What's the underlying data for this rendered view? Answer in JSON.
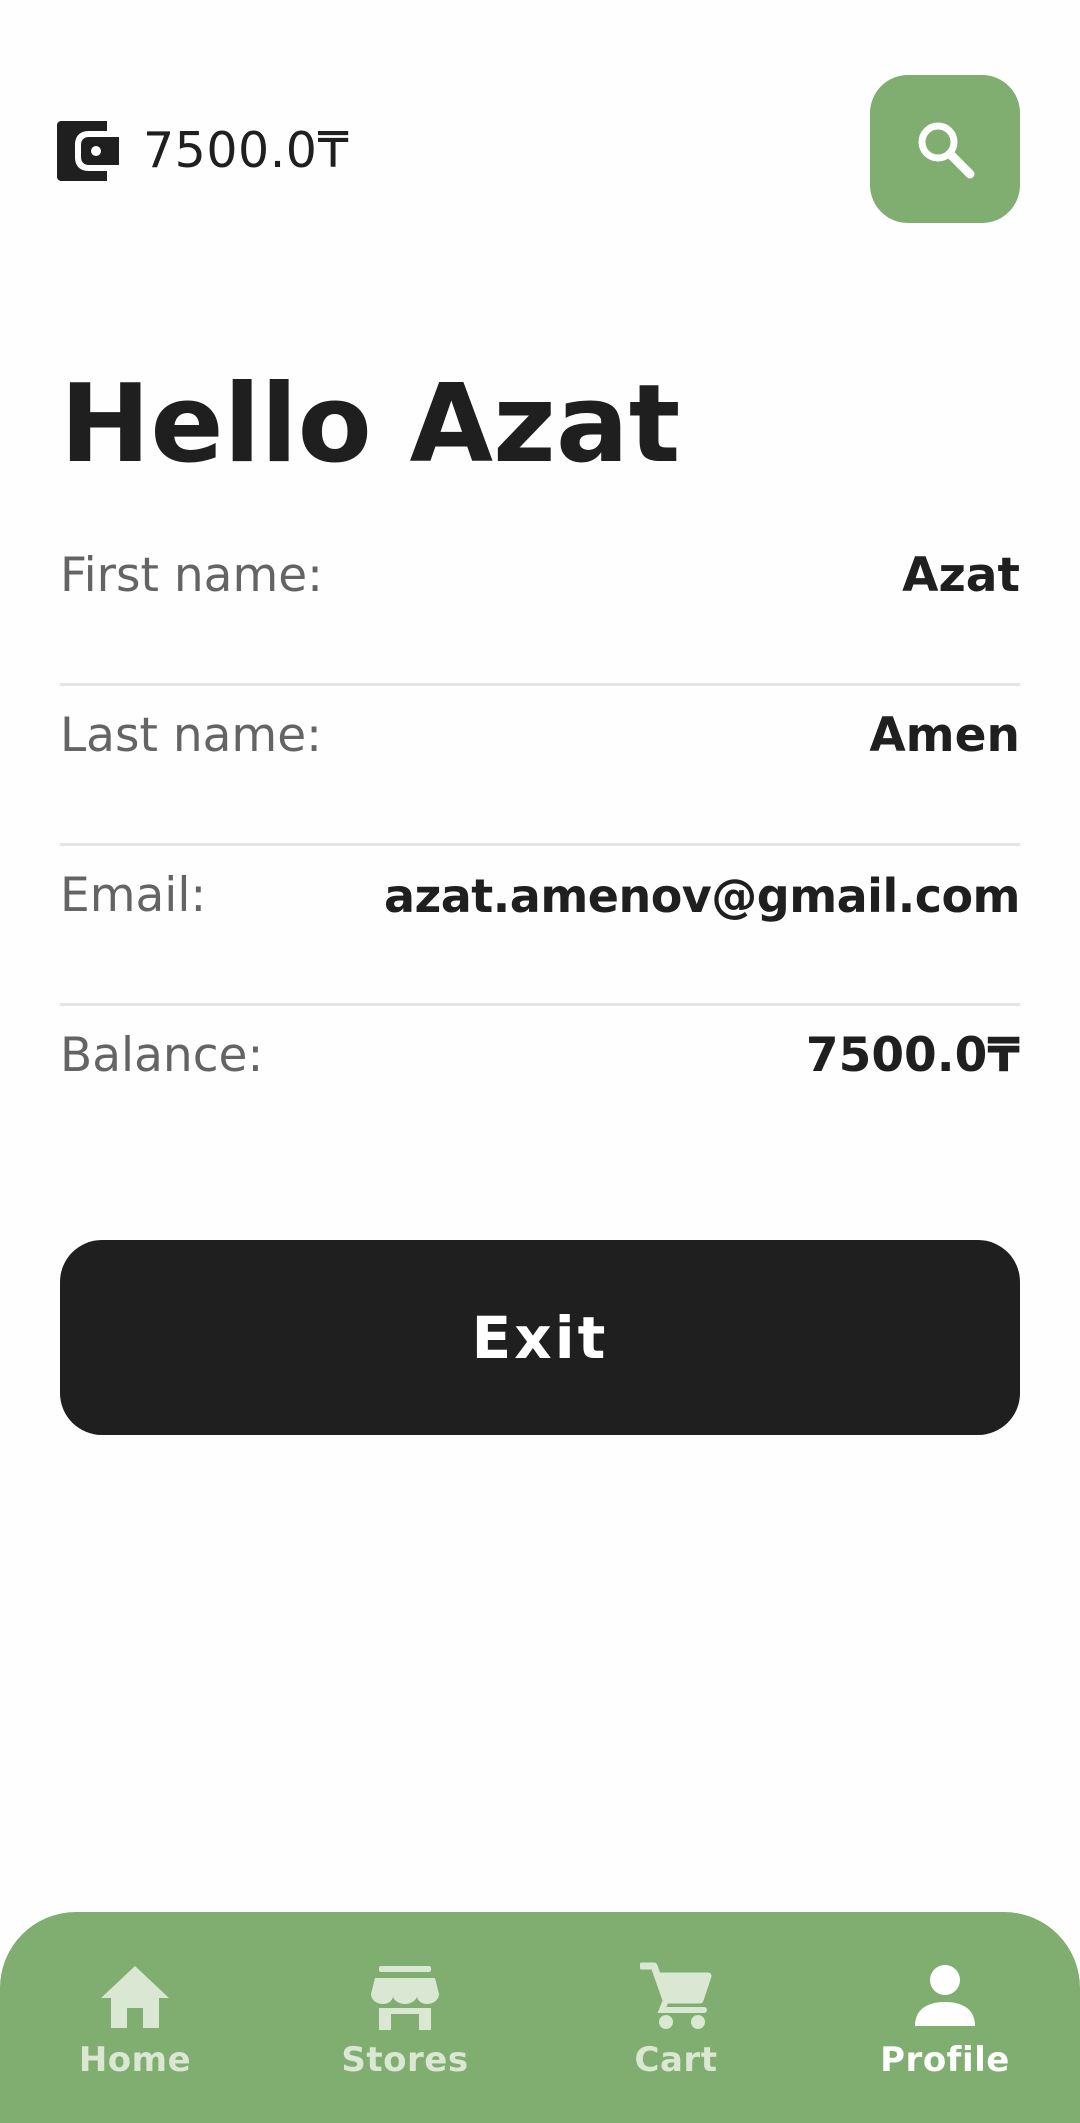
{
  "header": {
    "wallet_icon": "wallet-icon",
    "wallet_amount": "7500.0₸",
    "search_icon": "search-icon"
  },
  "greeting": "Hello Azat",
  "profile": {
    "fields": [
      {
        "label": "First name:",
        "value": "Azat"
      },
      {
        "label": "Last name:",
        "value": "Amen"
      },
      {
        "label": "Email:",
        "value": "azat.amenov@gmail.com"
      },
      {
        "label": "Balance:",
        "value": "7500.0₸"
      }
    ]
  },
  "exit_label": "Exit",
  "nav": {
    "active": "Profile",
    "items": [
      {
        "label": "Home",
        "icon": "home-icon"
      },
      {
        "label": "Stores",
        "icon": "store-icon"
      },
      {
        "label": "Cart",
        "icon": "cart-icon"
      },
      {
        "label": "Profile",
        "icon": "person-icon"
      }
    ]
  },
  "colors": {
    "accent": "#80ad70",
    "dark": "#1f1f1f",
    "label_grey": "#646464",
    "divider": "#e4e4e4",
    "nav_label_inactive": "#d9e7d3"
  }
}
